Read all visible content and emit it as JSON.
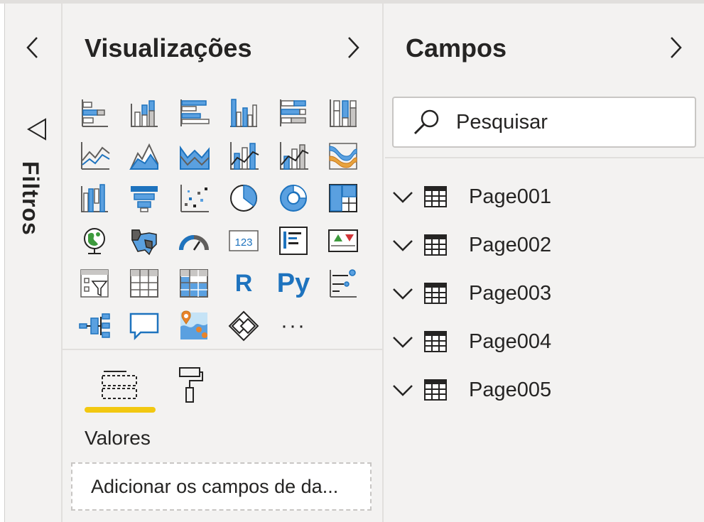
{
  "filters": {
    "label": "Filtros"
  },
  "visualizations": {
    "title": "Visualizações",
    "icons": [
      "stacked-bar-chart-icon",
      "stacked-column-chart-icon",
      "clustered-bar-chart-icon",
      "clustered-column-chart-icon",
      "100-percent-stacked-bar-chart-icon",
      "100-percent-stacked-column-chart-icon",
      "line-chart-icon",
      "area-chart-icon",
      "stacked-area-chart-icon",
      "line-and-stacked-column-chart-icon",
      "line-and-clustered-column-chart-icon",
      "ribbon-chart-icon",
      "waterfall-chart-icon",
      "funnel-chart-icon",
      "scatter-chart-icon",
      "pie-chart-icon",
      "donut-chart-icon",
      "treemap-icon",
      "map-icon",
      "filled-map-icon",
      "gauge-icon",
      "card-icon",
      "multi-row-card-icon",
      "kpi-icon",
      "slicer-icon",
      "table-icon",
      "matrix-icon",
      "r-script-visual-icon",
      "python-visual-icon",
      "key-influencers-icon",
      "decomposition-tree-icon",
      "qa-icon",
      "arcgis-map-icon",
      "power-apps-icon",
      "more-visuals-icon"
    ],
    "card_text": "123",
    "r_text": "R",
    "py_text": "Py",
    "more_text": "···",
    "section_label": "Valores",
    "well_placeholder": "Adicionar os campos de da..."
  },
  "fields": {
    "title": "Campos",
    "search_placeholder": "Pesquisar",
    "tables": [
      "Page001",
      "Page002",
      "Page003",
      "Page004",
      "Page005"
    ]
  },
  "colors": {
    "accent": "#f2c811",
    "icon_blue": "#1e73be",
    "icon_fill": "#5aa0e0",
    "icon_gray": "#605e5c"
  }
}
